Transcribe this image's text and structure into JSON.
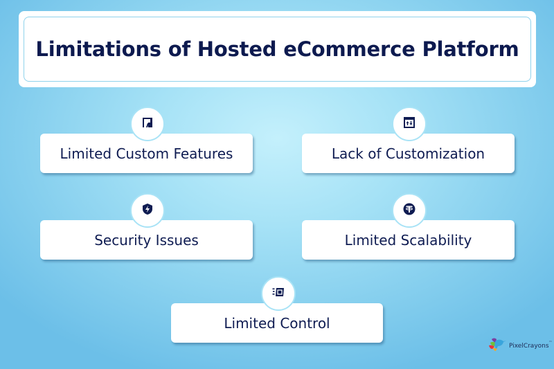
{
  "title": "Limitations of Hosted eCommerce Platform",
  "items": [
    {
      "label": "Limited Custom Features",
      "icon": "presentation-board-icon"
    },
    {
      "label": "Lack of Customization",
      "icon": "sort-arrows-icon"
    },
    {
      "label": "Security Issues",
      "icon": "shield-bolt-icon"
    },
    {
      "label": "Limited Scalability",
      "icon": "tether-coin-icon"
    },
    {
      "label": "Limited Control",
      "icon": "fast-window-icon"
    }
  ],
  "brand": {
    "name": "PixelCrayons",
    "trademark": "™"
  },
  "colors": {
    "title_text": "#0d1a4f",
    "icon": "#0f1c52",
    "badge_ring": "#a9e3f6"
  }
}
